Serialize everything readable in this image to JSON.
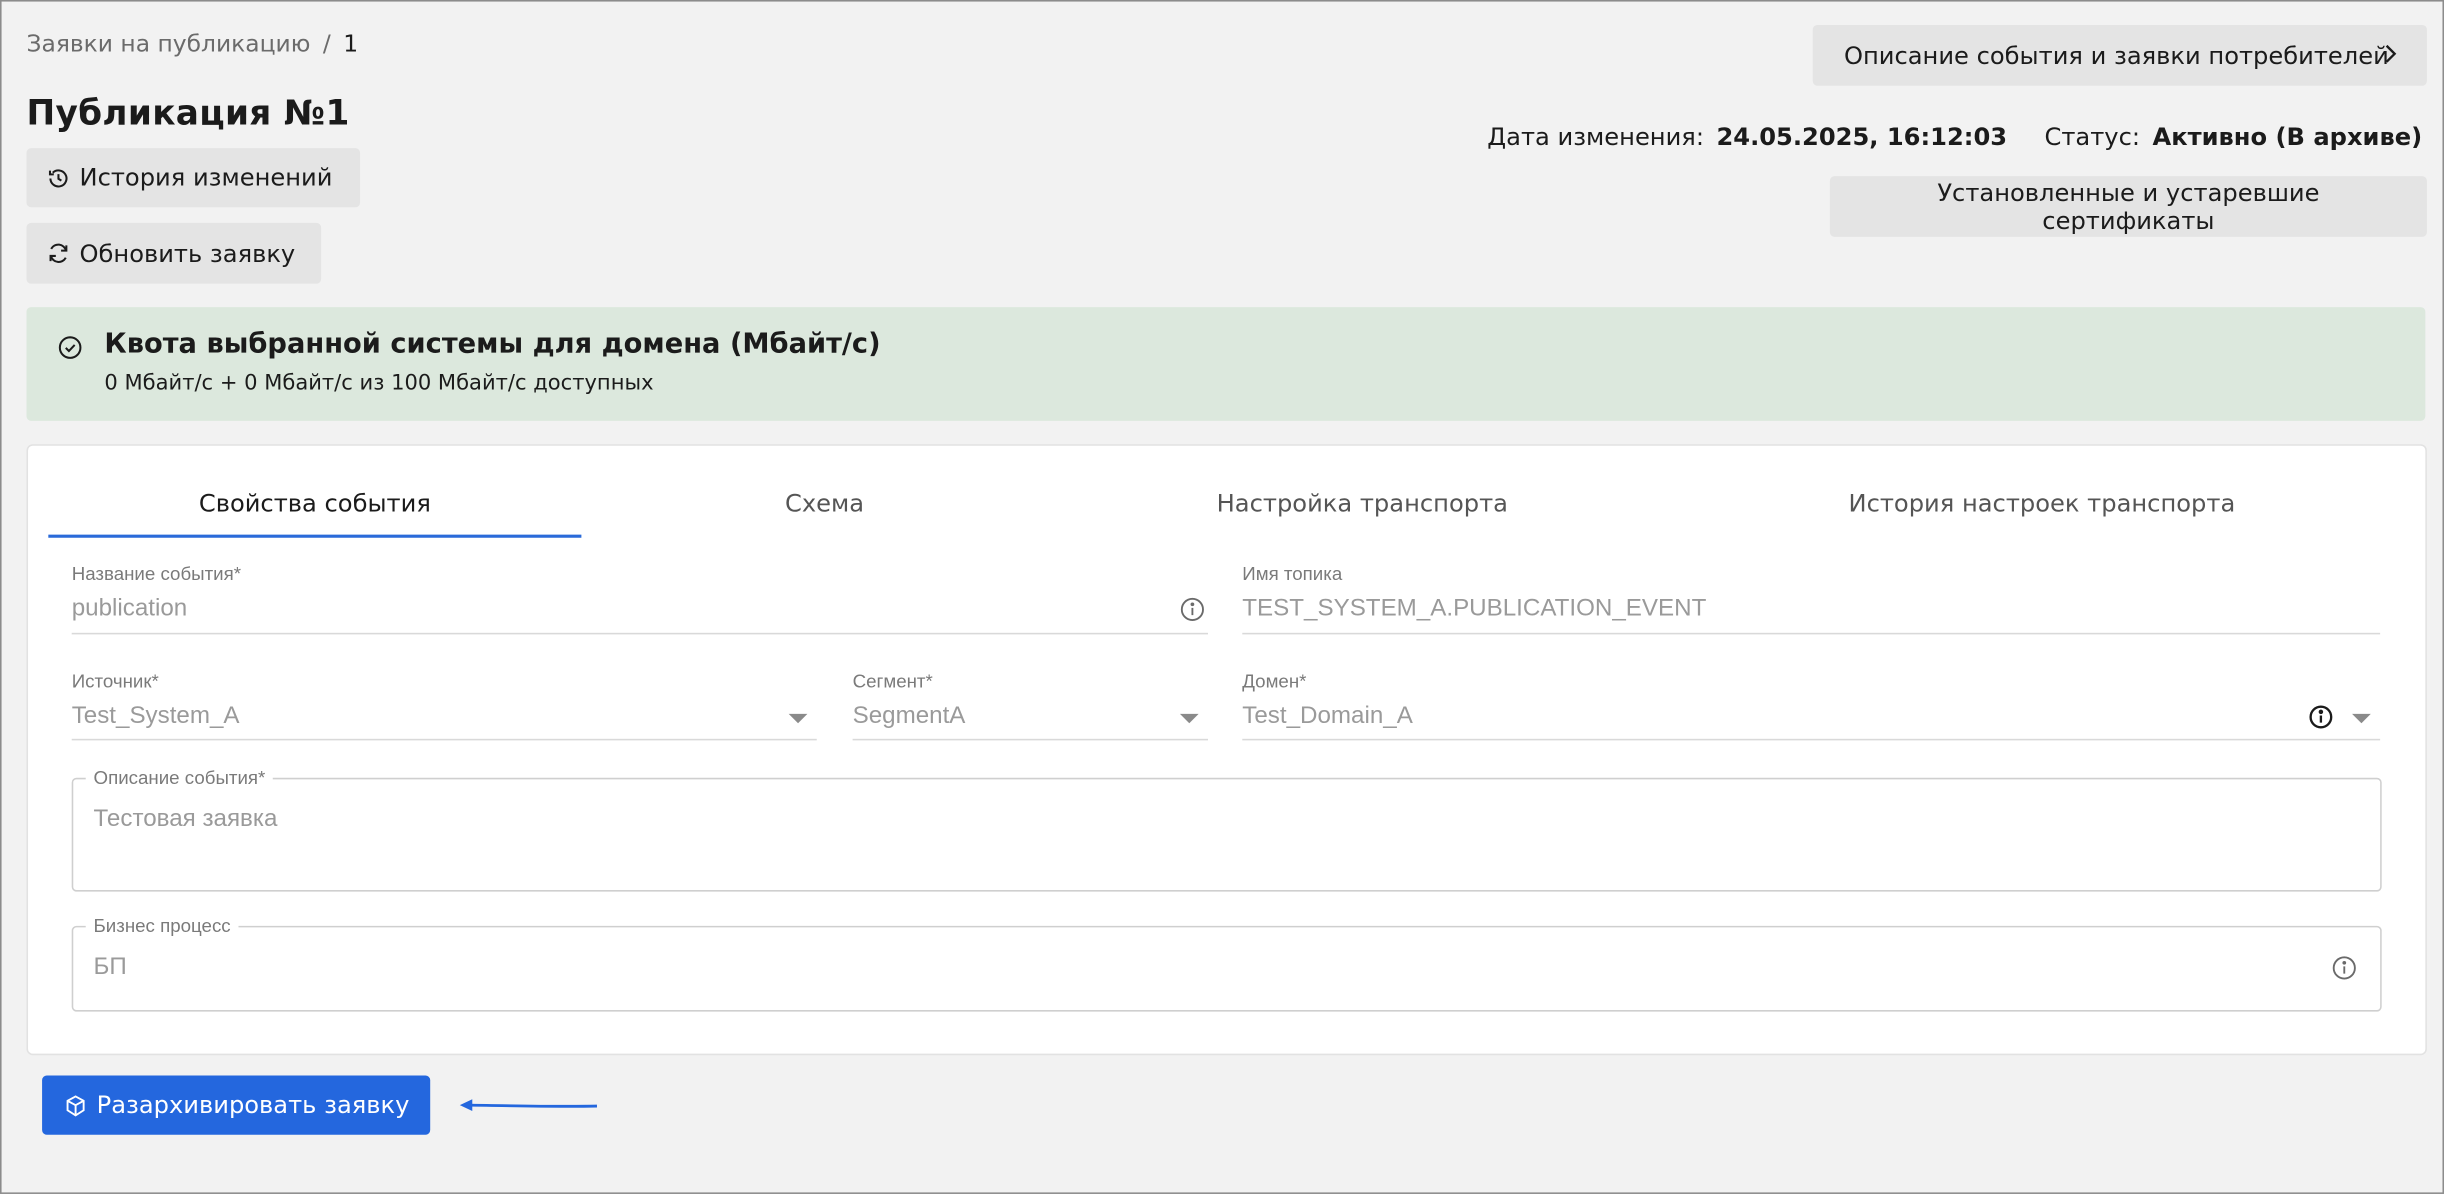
{
  "breadcrumb": {
    "parent": "Заявки на публикацию",
    "separator": "/",
    "current": "1"
  },
  "page_title": "Публикация №1",
  "actions": {
    "history": "История изменений",
    "refresh": "Обновить заявку",
    "describe": "Описание события и заявки потребителей",
    "certs": "Установленные и устаревшие сертификаты",
    "unarchive": "Разархивировать заявку"
  },
  "meta": {
    "changed_label": "Дата изменения:",
    "changed_value": "24.05.2025, 16:12:03",
    "status_label": "Статус:",
    "status_value": "Активно (В архиве)"
  },
  "quota": {
    "title": "Квота выбранной системы для домена (Мбайт/с)",
    "subtitle": "0 Мбайт/с + 0 Мбайт/с из 100 Мбайт/с доступных"
  },
  "tabs": [
    {
      "label": "Свойства события",
      "active": true
    },
    {
      "label": "Схема",
      "active": false
    },
    {
      "label": "Настройка транспорта",
      "active": false
    },
    {
      "label": "История настроек транспорта",
      "active": false
    }
  ],
  "form": {
    "event_name": {
      "label": "Название события",
      "required": "*",
      "value": "publication"
    },
    "topic_name": {
      "label": "Имя топика",
      "value": "TEST_SYSTEM_A.PUBLICATION_EVENT"
    },
    "source": {
      "label": "Источник",
      "required": "*",
      "value": "Test_System_A"
    },
    "segment": {
      "label": "Сегмент",
      "required": "*",
      "value": "SegmentA"
    },
    "domain": {
      "label": "Домен",
      "required": "*",
      "value": "Test_Domain_A"
    },
    "description": {
      "label": "Описание события",
      "required": "*",
      "value": "Тестовая заявка"
    },
    "business_process": {
      "label": "Бизнес процесс",
      "value": "БП"
    }
  },
  "colors": {
    "accent": "#2467de",
    "quota_bg": "#dce8dd",
    "page_bg": "#f2f2f2"
  }
}
